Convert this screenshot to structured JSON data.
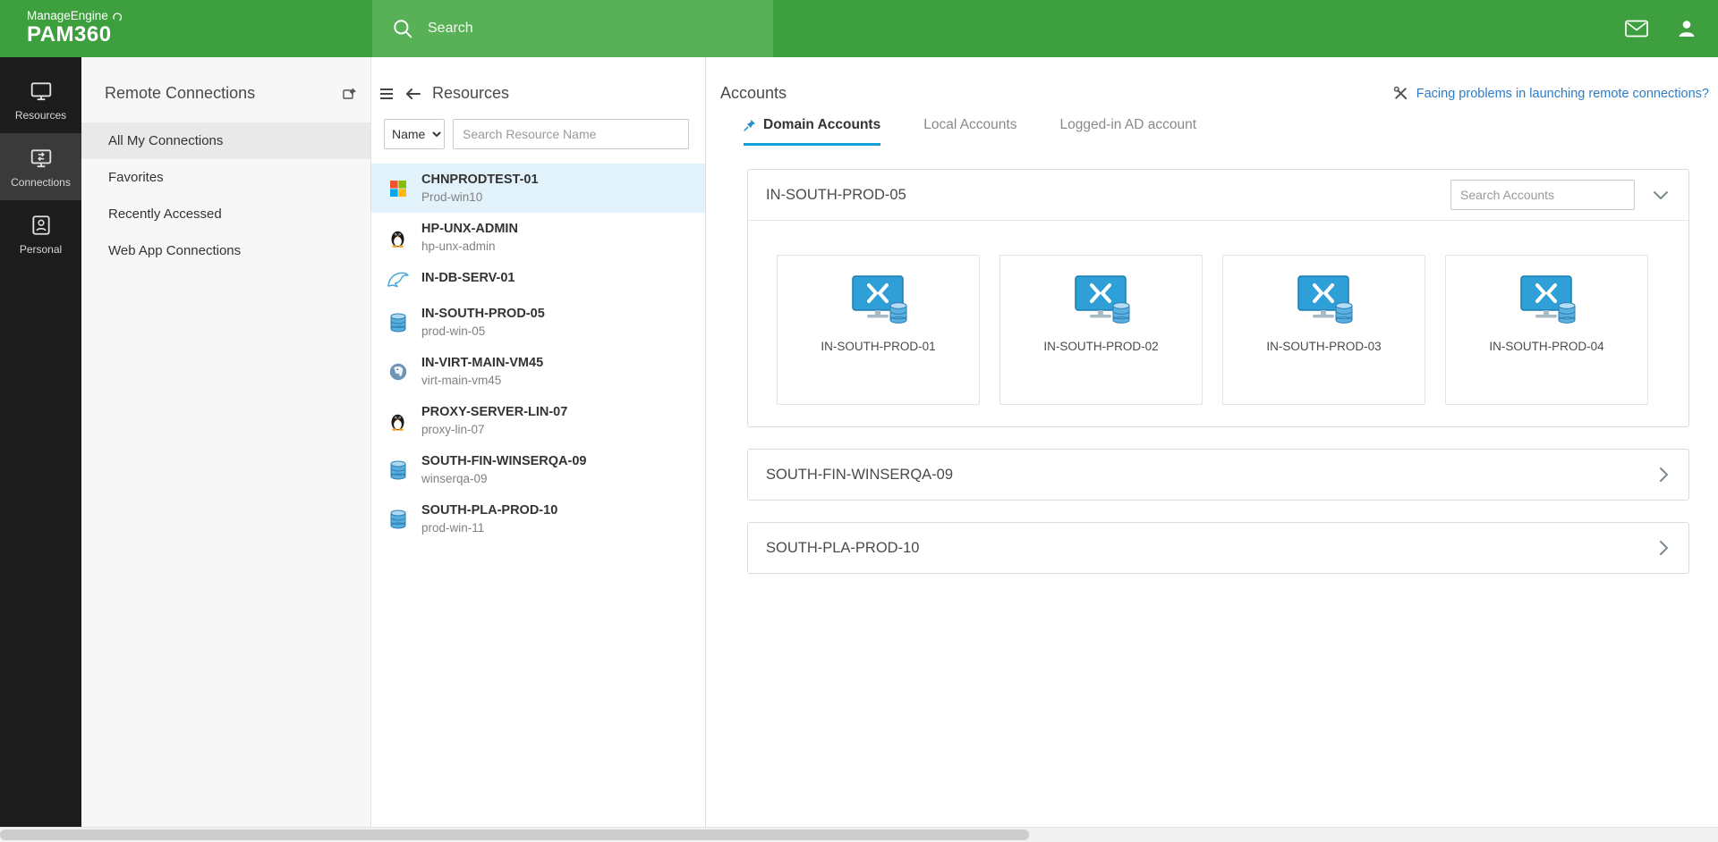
{
  "header": {
    "brand_top": "ManageEngine",
    "brand_bottom": "PAM360",
    "search_placeholder": "Search"
  },
  "nav": {
    "items": [
      {
        "label": "Resources"
      },
      {
        "label": "Connections"
      },
      {
        "label": "Personal"
      }
    ]
  },
  "connections_panel": {
    "title": "Remote Connections",
    "items": [
      {
        "label": "All My Connections"
      },
      {
        "label": "Favorites"
      },
      {
        "label": "Recently Accessed"
      },
      {
        "label": "Web App Connections"
      }
    ]
  },
  "resources_panel": {
    "title": "Resources",
    "filter_value": "Name",
    "search_placeholder": "Search Resource Name",
    "items": [
      {
        "name": "CHNPRODTEST-01",
        "sub": "Prod-win10",
        "icon": "windows"
      },
      {
        "name": "HP-UNX-ADMIN",
        "sub": "hp-unx-admin",
        "icon": "linux"
      },
      {
        "name": "IN-DB-SERV-01",
        "sub": "",
        "icon": "mysql"
      },
      {
        "name": "IN-SOUTH-PROD-05",
        "sub": "prod-win-05",
        "icon": "database"
      },
      {
        "name": "IN-VIRT-MAIN-VM45",
        "sub": "virt-main-vm45",
        "icon": "postgres"
      },
      {
        "name": "PROXY-SERVER-LIN-07",
        "sub": "proxy-lin-07",
        "icon": "linux"
      },
      {
        "name": "SOUTH-FIN-WINSERQA-09",
        "sub": "winserqa-09",
        "icon": "database"
      },
      {
        "name": "SOUTH-PLA-PROD-10",
        "sub": "prod-win-11",
        "icon": "database"
      }
    ]
  },
  "accounts_panel": {
    "title": "Accounts",
    "help_link": "Facing problems in launching remote connections?",
    "tabs": [
      {
        "label": "Domain Accounts"
      },
      {
        "label": "Local Accounts"
      },
      {
        "label": "Logged-in AD account"
      }
    ],
    "groups": [
      {
        "title": "IN-SOUTH-PROD-05",
        "search_placeholder": "Search Accounts",
        "accounts": [
          {
            "name": "IN-SOUTH-PROD-01"
          },
          {
            "name": "IN-SOUTH-PROD-02"
          },
          {
            "name": "IN-SOUTH-PROD-03"
          },
          {
            "name": "IN-SOUTH-PROD-04"
          }
        ]
      },
      {
        "title": "SOUTH-FIN-WINSERQA-09"
      },
      {
        "title": "SOUTH-PLA-PROD-10"
      }
    ]
  },
  "colors": {
    "header_green": "#3d9f3e",
    "search_strip_green": "#58b156",
    "accent_blue": "#14a0d6",
    "link_blue": "#2e7cc3",
    "selected_row_blue": "#e2f2fb",
    "sidebar_dark": "#1c1c1c"
  }
}
